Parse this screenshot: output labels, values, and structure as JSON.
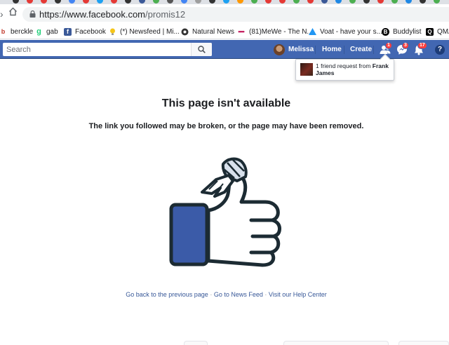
{
  "browser": {
    "url_host": "https://www.facebook.com",
    "url_path": "/promis12"
  },
  "bookmarks": [
    {
      "label": "berckle",
      "icon": "b-icon",
      "color": "#c0392b"
    },
    {
      "label": "gab",
      "icon": "gab-icon",
      "color": "#21cf7a"
    },
    {
      "label": "Facebook",
      "icon": "facebook-icon",
      "color": "#3b5998"
    },
    {
      "label": "(*) Newsfeed | Mi...",
      "icon": "lightbulb-icon",
      "color": "#f5c518"
    },
    {
      "label": "Natural News",
      "icon": "gear-icon",
      "color": "#333333"
    },
    {
      "label": "(81)MeWe - The N...",
      "icon": "mewe-icon",
      "color": "#c2185b"
    },
    {
      "label": "Voat - have your s...",
      "icon": "voat-icon",
      "color": "#2196f3"
    },
    {
      "label": "Buddylist",
      "icon": "buddylist-icon",
      "color": "#000000"
    },
    {
      "label": "QMA",
      "icon": "qmap-icon",
      "color": "#000000"
    }
  ],
  "fb_header": {
    "search_placeholder": "Search",
    "profile_name": "Melissa",
    "home_label": "Home",
    "create_label": "Create",
    "friend_requests_count": "1",
    "messages_count": "3",
    "notifications_count": "17",
    "help_label": "?",
    "brand_color": "#4267b2"
  },
  "flyout": {
    "message_prefix": "1 friend request from ",
    "message_name": "Frank James"
  },
  "error_page": {
    "title": "This page isn't available",
    "subtitle": "The link you followed may be broken, or the page may have been removed.",
    "link_back": "Go back to the previous page",
    "link_feed": "Go to News Feed",
    "link_help": "Visit our Help Center",
    "separator": "·"
  }
}
